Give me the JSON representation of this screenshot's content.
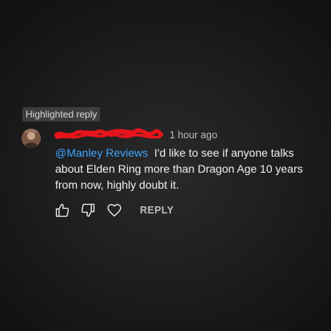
{
  "highlight_badge": "Highlighted reply",
  "comment": {
    "timestamp": "1 hour ago",
    "mention": "@Manley Reviews",
    "text": "I'd like to see if anyone talks about Elden Ring more than Dragon Age 10 years from now, highly doubt it."
  },
  "actions": {
    "like_icon": "thumbs-up-icon",
    "dislike_icon": "thumbs-down-icon",
    "heart_icon": "heart-icon",
    "reply_label": "REPLY"
  },
  "colors": {
    "mention": "#3ea6ff",
    "redaction": "#e8141c",
    "badge_bg": "#3d3d3d",
    "secondary_text": "#bdbdbd"
  }
}
